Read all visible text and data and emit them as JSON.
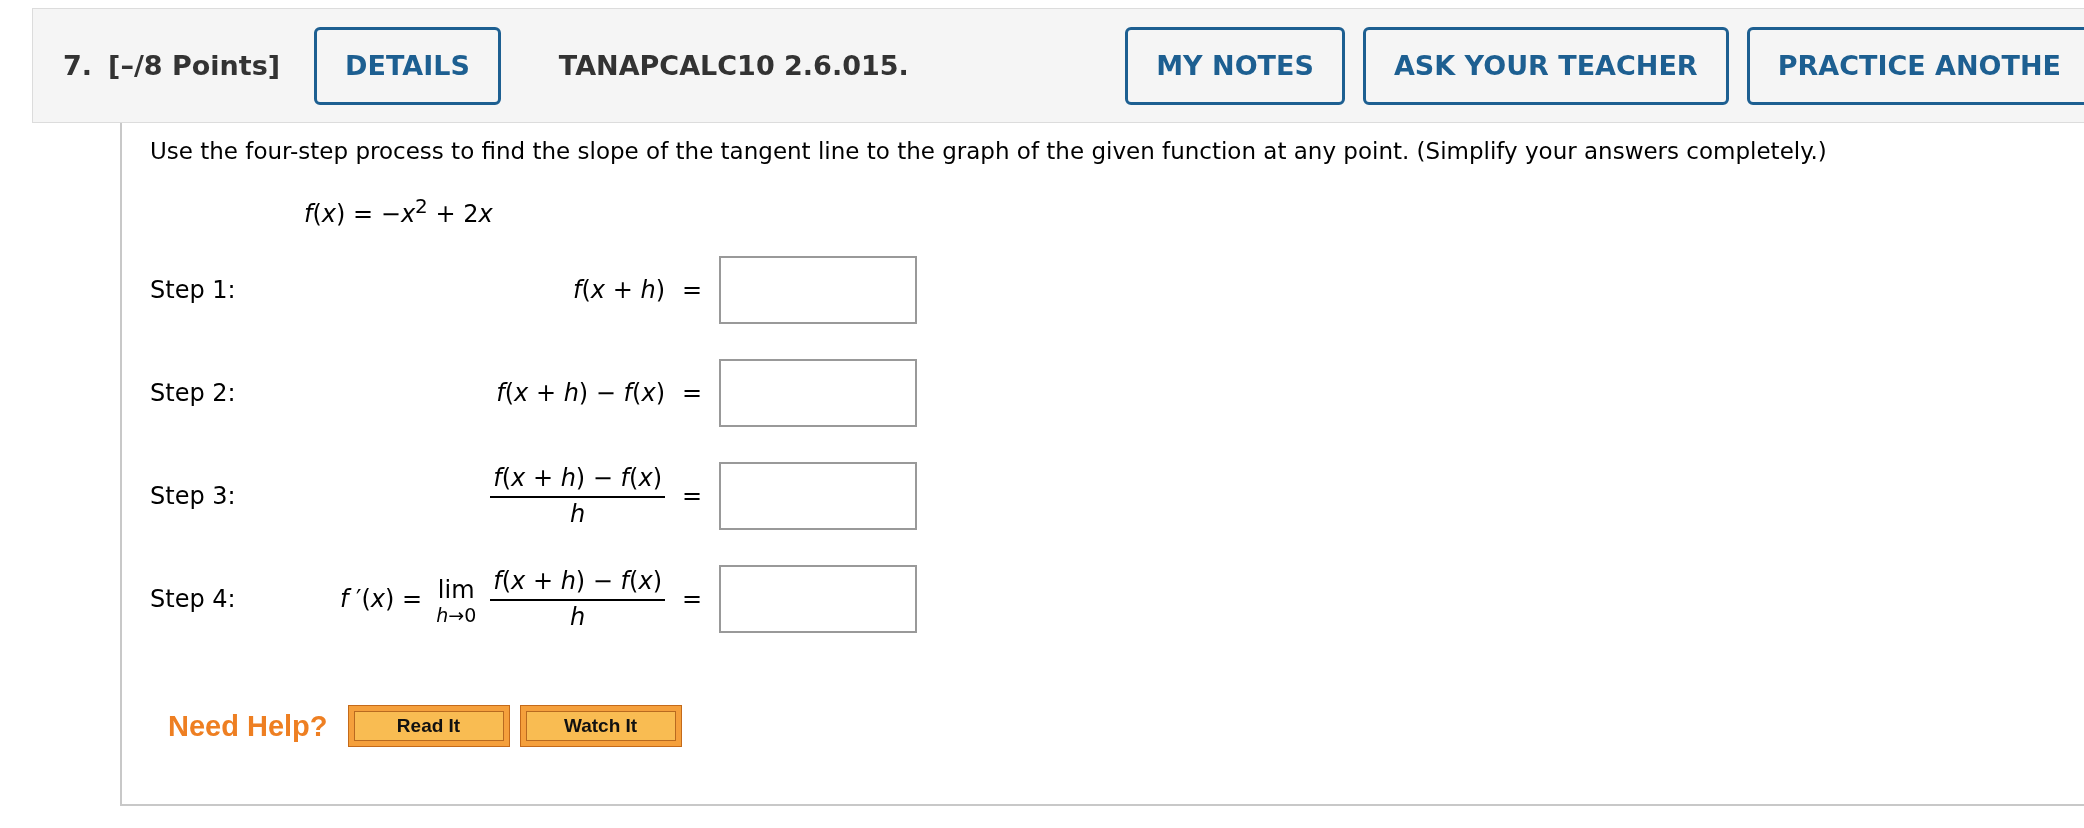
{
  "question": {
    "number": "7.",
    "points": "[–/8 Points]",
    "details_button": "DETAILS",
    "code": "TANAPCALC10 2.6.015.",
    "header_buttons": [
      "MY NOTES",
      "ASK YOUR TEACHER",
      "PRACTICE ANOTHE"
    ]
  },
  "instructions": "Use the four-step process to find the slope of the tangent line to the graph of the given function at any point. (Simplify your answers completely.)",
  "function": [
    {
      "kind": "var",
      "text": "f"
    },
    {
      "kind": "text",
      "text": "("
    },
    {
      "kind": "var",
      "text": "x"
    },
    {
      "kind": "text",
      "text": ") = −"
    },
    {
      "kind": "var",
      "text": "x"
    },
    {
      "kind": "sup",
      "text": "2"
    },
    {
      "kind": "text",
      "text": " + 2"
    },
    {
      "kind": "var",
      "text": "x"
    }
  ],
  "steps": [
    {
      "label": "Step 1:",
      "kind": "plain",
      "expression": "*f*(*x* + *h*)",
      "equals": "="
    },
    {
      "label": "Step 2:",
      "kind": "plain",
      "expression": "*f*(*x* + *h*) − *f*(*x*)",
      "equals": "="
    },
    {
      "label": "Step 3:",
      "kind": "fraction",
      "numerator": "*f*(*x* + *h*) − *f*(*x*)",
      "denominator": "*h*",
      "equals": "="
    },
    {
      "label": "Step 4:",
      "kind": "limit",
      "prefix": "*f* ′(*x*) =",
      "limit": "lim",
      "limit_under": "*h*→0",
      "numerator": "*f*(*x* + *h*) − *f*(*x*)",
      "denominator": "*h*",
      "equals": "="
    }
  ],
  "help": {
    "label": "Need Help?",
    "buttons": [
      "Read It",
      "Watch It"
    ]
  }
}
